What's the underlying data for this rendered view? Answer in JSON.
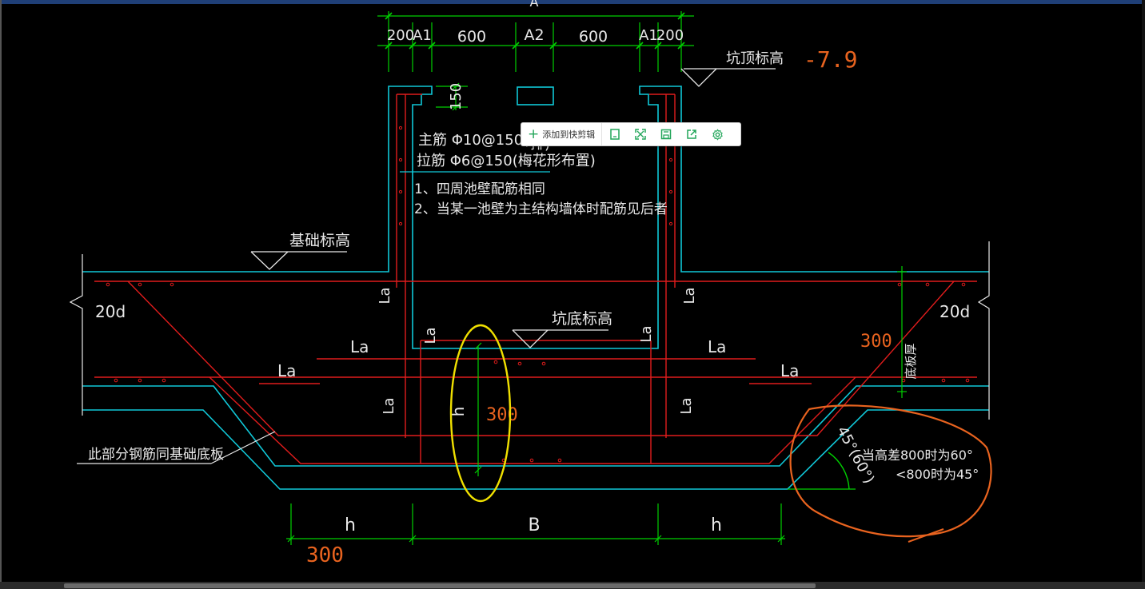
{
  "dims_top": [
    "200",
    "A1",
    "600",
    "A2",
    "600",
    "A1",
    "200"
  ],
  "dim_top_A": "A",
  "dim_150": "150",
  "pit_top_label": "坑顶标高",
  "pit_top_value": "-7.9",
  "rebar_main": "主筋 Φ10@150(双",
  "rebar_main_tail": "排)",
  "rebar_tie": "拉筋 Φ6@150(梅花形布置)",
  "note_1": "1、四周池壁配筋相同",
  "note_2": "2、当某一池壁为主结构墙体时配筋见后者",
  "foundation_label": "基础标高",
  "pit_bottom_label": "坑底标高",
  "anchor_20d": "20d",
  "la": "La",
  "h": "h",
  "b": "B",
  "red_300": "300",
  "slab_note": "此部分钢筋同基础底板",
  "thickness_label": "底板厚",
  "slope_label": "45°(60°)",
  "slope_note_1": "当高差800时为60°",
  "slope_note_2": "<800时为45°",
  "toolbar": {
    "add_label": "添加到快剪辑",
    "icons": [
      "copy-icon",
      "expand-icon",
      "save-icon",
      "share-icon",
      "settings-icon"
    ],
    "accent": "#21a559"
  },
  "colors": {
    "background": "#000000",
    "dimension": "#00d000",
    "rebar": "#e01c1c",
    "outline": "#10c8d8",
    "text": "#e8e8e8",
    "annotation": "#e8631f",
    "highlight": "#f0e000"
  }
}
